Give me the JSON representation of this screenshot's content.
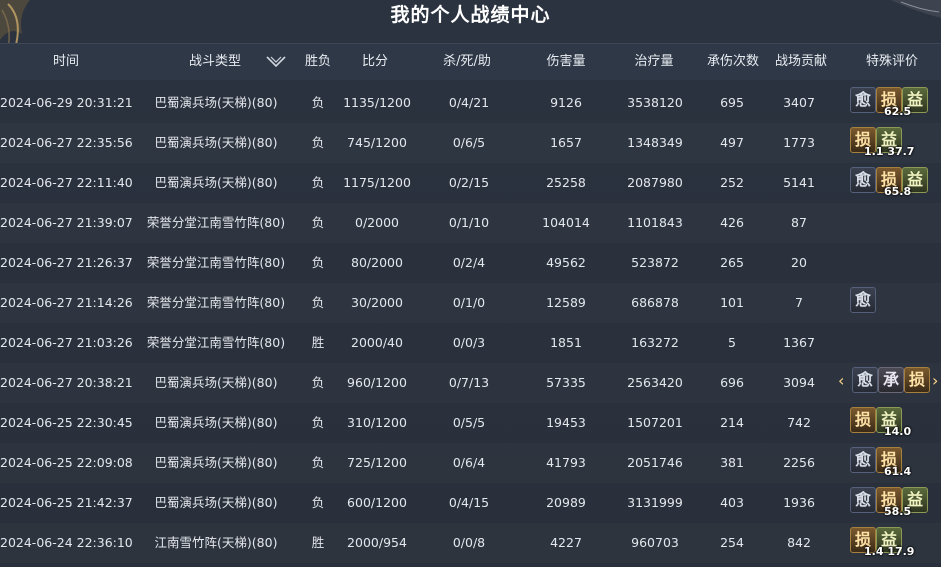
{
  "window": {
    "title": "我的个人战绩中心"
  },
  "header": {
    "time": "时间",
    "battle_type": "战斗类型",
    "result": "胜负",
    "score": "比分",
    "kda": "杀/死/助",
    "damage": "伤害量",
    "healing": "治疗量",
    "hits_taken": "承伤次数",
    "contribution": "战场贡献",
    "special": "特殊评价"
  },
  "colors": {
    "accent": "#f0d79a",
    "header_bg": "#2f3847",
    "page_bg": "#2a313d"
  },
  "rows": [
    {
      "time": "2024-06-29 20:31:21",
      "type": "巴蜀演兵场(天梯)(80)",
      "result": "负",
      "score": "1135/1200",
      "kda": "0/4/21",
      "damage": "9126",
      "healing": "3538120",
      "tank": "695",
      "contrib": "3407",
      "badges": [
        {
          "g": "愈",
          "k": "a"
        },
        {
          "g": "损",
          "k": "b"
        },
        {
          "g": "益",
          "k": "c"
        }
      ],
      "eval_score": "62.5",
      "arrows": false
    },
    {
      "time": "2024-06-27 22:35:56",
      "type": "巴蜀演兵场(天梯)(80)",
      "result": "负",
      "score": "745/1200",
      "kda": "0/6/5",
      "damage": "1657",
      "healing": "1348349",
      "tank": "497",
      "contrib": "1773",
      "badges": [
        {
          "g": "损",
          "k": "b"
        },
        {
          "g": "益",
          "k": "c"
        }
      ],
      "eval_score": "1.1 37.7",
      "arrows": false
    },
    {
      "time": "2024-06-27 22:11:40",
      "type": "巴蜀演兵场(天梯)(80)",
      "result": "负",
      "score": "1175/1200",
      "kda": "0/2/15",
      "damage": "25258",
      "healing": "2087980",
      "tank": "252",
      "contrib": "5141",
      "badges": [
        {
          "g": "愈",
          "k": "a"
        },
        {
          "g": "损",
          "k": "b"
        },
        {
          "g": "益",
          "k": "c"
        }
      ],
      "eval_score": "65.8",
      "arrows": false
    },
    {
      "time": "2024-06-27 21:39:07",
      "type": "荣誉分堂江南雪竹阵(80)",
      "result": "负",
      "score": "0/2000",
      "kda": "0/1/10",
      "damage": "104014",
      "healing": "1101843",
      "tank": "426",
      "contrib": "87",
      "badges": [],
      "eval_score": "",
      "arrows": false
    },
    {
      "time": "2024-06-27 21:26:37",
      "type": "荣誉分堂江南雪竹阵(80)",
      "result": "负",
      "score": "80/2000",
      "kda": "0/2/4",
      "damage": "49562",
      "healing": "523872",
      "tank": "265",
      "contrib": "20",
      "badges": [],
      "eval_score": "",
      "arrows": false
    },
    {
      "time": "2024-06-27 21:14:26",
      "type": "荣誉分堂江南雪竹阵(80)",
      "result": "负",
      "score": "30/2000",
      "kda": "0/1/0",
      "damage": "12589",
      "healing": "686878",
      "tank": "101",
      "contrib": "7",
      "badges": [
        {
          "g": "愈",
          "k": "a"
        }
      ],
      "eval_score": "",
      "arrows": false
    },
    {
      "time": "2024-06-27 21:03:26",
      "type": "荣誉分堂江南雪竹阵(80)",
      "result": "胜",
      "score": "2000/40",
      "kda": "0/0/3",
      "damage": "1851",
      "healing": "163272",
      "tank": "5",
      "contrib": "1367",
      "badges": [],
      "eval_score": "",
      "arrows": false
    },
    {
      "time": "2024-06-27 20:38:21",
      "type": "巴蜀演兵场(天梯)(80)",
      "result": "负",
      "score": "960/1200",
      "kda": "0/7/13",
      "damage": "57335",
      "healing": "2563420",
      "tank": "696",
      "contrib": "3094",
      "badges": [
        {
          "g": "愈",
          "k": "a"
        },
        {
          "g": "承",
          "k": "d"
        },
        {
          "g": "损",
          "k": "b"
        }
      ],
      "eval_score": "",
      "arrows": true
    },
    {
      "time": "2024-06-25 22:30:45",
      "type": "巴蜀演兵场(天梯)(80)",
      "result": "负",
      "score": "310/1200",
      "kda": "0/5/5",
      "damage": "19453",
      "healing": "1507201",
      "tank": "214",
      "contrib": "742",
      "badges": [
        {
          "g": "损",
          "k": "b"
        },
        {
          "g": "益",
          "k": "c"
        }
      ],
      "eval_score": "14.0",
      "arrows": false
    },
    {
      "time": "2024-06-25 22:09:08",
      "type": "巴蜀演兵场(天梯)(80)",
      "result": "负",
      "score": "725/1200",
      "kda": "0/6/4",
      "damage": "41793",
      "healing": "2051746",
      "tank": "381",
      "contrib": "2256",
      "badges": [
        {
          "g": "愈",
          "k": "a"
        },
        {
          "g": "损",
          "k": "b"
        }
      ],
      "eval_score": "61.4",
      "arrows": false
    },
    {
      "time": "2024-06-25 21:42:37",
      "type": "巴蜀演兵场(天梯)(80)",
      "result": "负",
      "score": "600/1200",
      "kda": "0/4/15",
      "damage": "20989",
      "healing": "3131999",
      "tank": "403",
      "contrib": "1936",
      "badges": [
        {
          "g": "愈",
          "k": "a"
        },
        {
          "g": "损",
          "k": "b"
        },
        {
          "g": "益",
          "k": "c"
        }
      ],
      "eval_score": "58.5",
      "arrows": false
    },
    {
      "time": "2024-06-24 22:36:10",
      "type": "江南雪竹阵(天梯)(80)",
      "result": "胜",
      "score": "2000/954",
      "kda": "0/0/8",
      "damage": "4227",
      "healing": "960703",
      "tank": "254",
      "contrib": "842",
      "badges": [
        {
          "g": "损",
          "k": "b"
        },
        {
          "g": "益",
          "k": "c"
        }
      ],
      "eval_score": "1.4 17.9",
      "arrows": false
    }
  ]
}
